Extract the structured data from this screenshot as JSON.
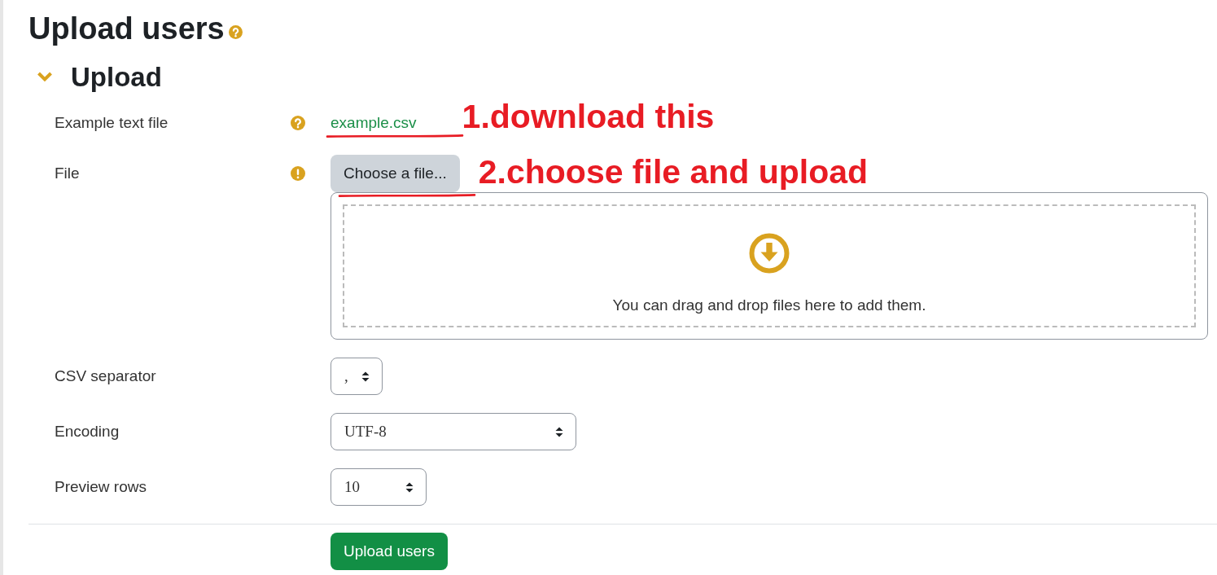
{
  "page": {
    "title": "Upload users",
    "help": true
  },
  "section": {
    "title": "Upload",
    "expanded": true
  },
  "fields": [
    {
      "kind": "link",
      "label": "Example text file",
      "help": true,
      "required": false,
      "value": "example.csv",
      "annotation": "1.download this"
    },
    {
      "kind": "filepicker",
      "label": "File",
      "help": false,
      "required": true,
      "button": "Choose a file...",
      "dropzone_text": "You can drag and drop files here to add them.",
      "annotation": "2.choose file and upload"
    },
    {
      "kind": "select",
      "label": "CSV separator",
      "help": false,
      "required": false,
      "value": ","
    },
    {
      "kind": "select",
      "label": "Encoding",
      "help": false,
      "required": false,
      "value": "UTF-8"
    },
    {
      "kind": "select",
      "label": "Preview rows",
      "help": false,
      "required": false,
      "value": "10"
    }
  ],
  "submit": "Upload users"
}
